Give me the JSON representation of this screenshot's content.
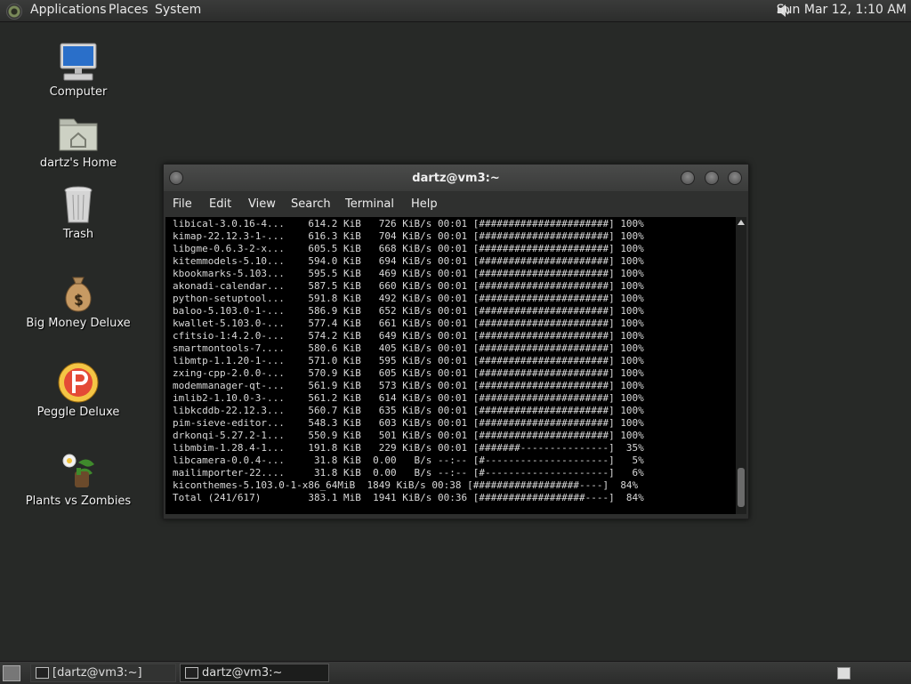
{
  "top_panel": {
    "menus": [
      "Applications",
      "Places",
      "System"
    ],
    "clock": "Sun Mar 12,  1:10 AM"
  },
  "desktop_icons": [
    {
      "label": "Computer",
      "icon": "computer-icon"
    },
    {
      "label": "dartz's Home",
      "icon": "home-folder-icon"
    },
    {
      "label": "Trash",
      "icon": "trash-icon"
    },
    {
      "label": "Big Money Deluxe",
      "icon": "money-bag-icon"
    },
    {
      "label": "Peggle Deluxe",
      "icon": "peggle-icon"
    },
    {
      "label": "Plants vs Zombies",
      "icon": "plants-vs-zombies-icon"
    }
  ],
  "terminal": {
    "title": "dartz@vm3:~",
    "menu": [
      "File",
      "Edit",
      "View",
      "Search",
      "Terminal",
      "Help"
    ],
    "lines": [
      "libical-3.0.16-4...    614.2 KiB   726 KiB/s 00:01 [######################] 100%",
      "kimap-22.12.3-1-...    616.3 KiB   704 KiB/s 00:01 [######################] 100%",
      "libgme-0.6.3-2-x...    605.5 KiB   668 KiB/s 00:01 [######################] 100%",
      "kitemmodels-5.10...    594.0 KiB   694 KiB/s 00:01 [######################] 100%",
      "kbookmarks-5.103...    595.5 KiB   469 KiB/s 00:01 [######################] 100%",
      "akonadi-calendar...    587.5 KiB   660 KiB/s 00:01 [######################] 100%",
      "python-setuptool...    591.8 KiB   492 KiB/s 00:01 [######################] 100%",
      "baloo-5.103.0-1-...    586.9 KiB   652 KiB/s 00:01 [######################] 100%",
      "kwallet-5.103.0-...    577.4 KiB   661 KiB/s 00:01 [######################] 100%",
      "cfitsio-1:4.2.0-...    574.2 KiB   649 KiB/s 00:01 [######################] 100%",
      "smartmontools-7....    580.6 KiB   405 KiB/s 00:01 [######################] 100%",
      "libmtp-1.1.20-1-...    571.0 KiB   595 KiB/s 00:01 [######################] 100%",
      "zxing-cpp-2.0.0-...    570.9 KiB   605 KiB/s 00:01 [######################] 100%",
      "modemmanager-qt-...    561.9 KiB   573 KiB/s 00:01 [######################] 100%",
      "imlib2-1.10.0-3-...    561.2 KiB   614 KiB/s 00:01 [######################] 100%",
      "libkcddb-22.12.3...    560.7 KiB   635 KiB/s 00:01 [######################] 100%",
      "pim-sieve-editor...    548.3 KiB   603 KiB/s 00:01 [######################] 100%",
      "drkonqi-5.27.2-1...    550.9 KiB   501 KiB/s 00:01 [######################] 100%",
      "libmbim-1.28.4-1...    191.8 KiB   229 KiB/s 00:01 [#######---------------]  35%",
      "libcamera-0.0.4-...     31.8 KiB  0.00   B/s --:-- [#---------------------]   5%",
      "mailimporter-22....     31.8 KiB  0.00   B/s --:-- [#---------------------]   6%",
      "kiconthemes-5.103.0-1-x86_64MiB  1849 KiB/s 00:38 [##################----]  84%",
      "Total (241/617)        383.1 MiB  1941 KiB/s 00:36 [##################----]  84%"
    ]
  },
  "taskbar": {
    "items": [
      "[dartz@vm3:~]",
      "dartz@vm3:~"
    ]
  }
}
